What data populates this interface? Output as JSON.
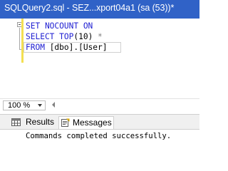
{
  "window": {
    "tab_title": "SQLQuery2.sql - SEZ...xport04a1 (sa (53))*"
  },
  "editor": {
    "lines": [
      {
        "kw": "SET NOCOUNT ON",
        "rest": ""
      },
      {
        "kw": "SELECT TOP",
        "rest": "(10)",
        "op": " *"
      },
      {
        "kw": "FROM",
        "rest": " [dbo].[User]"
      }
    ]
  },
  "zoom": {
    "value": "100 %"
  },
  "results_tabs": {
    "results_label": "Results",
    "messages_label": "Messages"
  },
  "messages": {
    "text": "Commands completed successfully."
  },
  "icons": {
    "results": "grid-icon",
    "messages": "message-icon",
    "zoom_dropdown": "chevron-down-icon",
    "collapse": "minus-box-icon"
  },
  "colors": {
    "title_bar": "#3062c7",
    "keyword": "#1e1ed2",
    "operator": "#808080",
    "change_bar": "#f3df52"
  }
}
